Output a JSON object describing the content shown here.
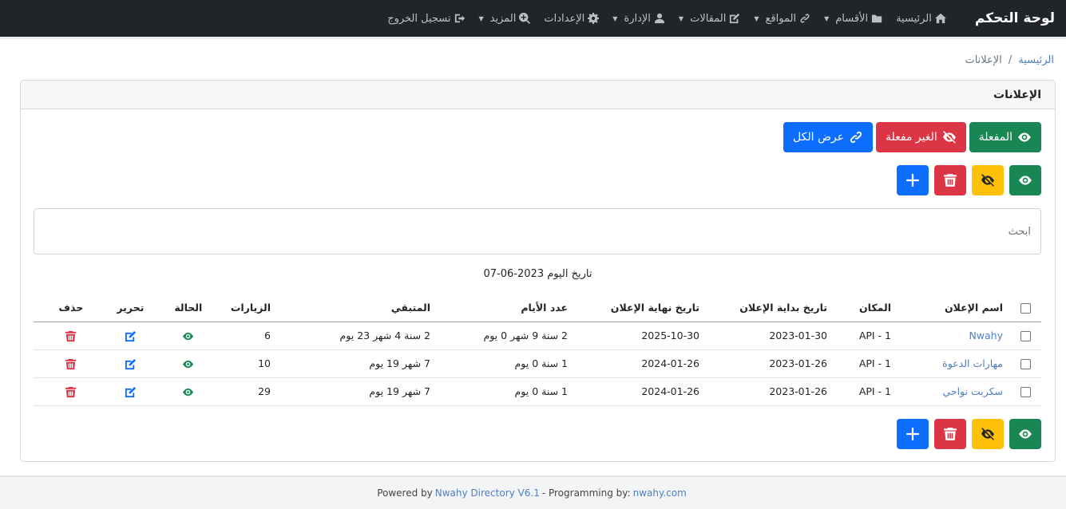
{
  "nav": {
    "brand": "لوحة التحكم",
    "items": [
      {
        "label": "الرئيسية",
        "icon": "home-icon",
        "dropdown": false
      },
      {
        "label": "الأقسام",
        "icon": "folder-icon",
        "dropdown": true
      },
      {
        "label": "المواقع",
        "icon": "link-icon",
        "dropdown": true
      },
      {
        "label": "المقالات",
        "icon": "edit-icon",
        "dropdown": true
      },
      {
        "label": "الإدارة",
        "icon": "user-icon",
        "dropdown": true
      },
      {
        "label": "الإعدادات",
        "icon": "gear-icon",
        "dropdown": false
      },
      {
        "label": "المزيد",
        "icon": "search-plus-icon",
        "dropdown": true
      },
      {
        "label": "تسجيل الخروج",
        "icon": "sign-out-icon",
        "dropdown": false
      }
    ]
  },
  "breadcrumb": {
    "home": "الرئيسية",
    "current": "الإعلانات"
  },
  "card": {
    "title": "الإعلانات"
  },
  "filters": {
    "active": "المفعلة",
    "inactive": "الغير مفعلة",
    "all": "عرض الكل"
  },
  "search": {
    "placeholder": "ابحث"
  },
  "today": "تاريخ اليوم 2023-06-07",
  "table": {
    "headers": [
      "اسم الإعلان",
      "المكان",
      "تاريخ بداية الإعلان",
      "تاريخ نهاية الإعلان",
      "عدد الأيام",
      "المتبقي",
      "الزيارات",
      "الحالة",
      "تحرير",
      "حذف"
    ],
    "rows": [
      {
        "name": "Nwahy",
        "place": "API - 1",
        "start": "2023-01-30",
        "end": "2025-10-30",
        "days": "2 سنة 9 شهر 0 يوم",
        "remaining": "2 سنة 4 شهر 23 يوم",
        "visits": "6"
      },
      {
        "name": "مهارات الدعوة",
        "place": "API - 1",
        "start": "2023-01-26",
        "end": "2024-01-26",
        "days": "1 سنة 0 يوم",
        "remaining": "7 شهر 19 يوم",
        "visits": "10"
      },
      {
        "name": "سكربت نواحي",
        "place": "API - 1",
        "start": "2023-01-26",
        "end": "2024-01-26",
        "days": "1 سنة 0 يوم",
        "remaining": "7 شهر 19 يوم",
        "visits": "29"
      }
    ]
  },
  "footer": {
    "powered": "Powered by",
    "product": "Nwahy Directory V6.1",
    "programming": "- Programming by:",
    "site": "nwahy.com"
  }
}
